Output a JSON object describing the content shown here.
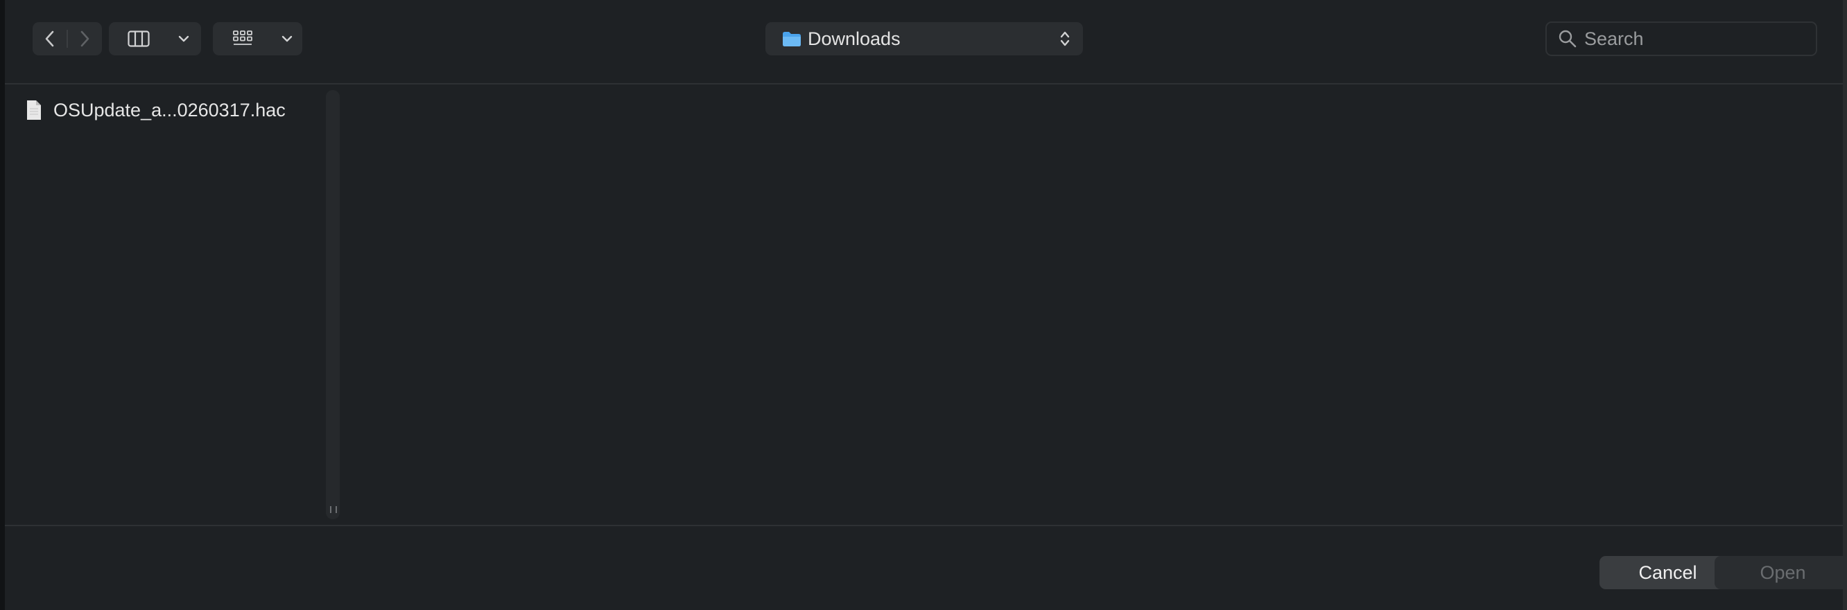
{
  "toolbar": {
    "back_icon": "chevron-left-icon",
    "forward_icon": "chevron-right-icon",
    "view_icon": "column-view-icon",
    "group_icon": "grid-group-icon",
    "location": {
      "label": "Downloads",
      "icon": "folder-icon",
      "folder_color": "#5aaef2"
    },
    "search": {
      "placeholder": "Search"
    }
  },
  "browser": {
    "files": [
      {
        "name": "OSUpdate_a...0260317.hac",
        "icon": "document-icon"
      }
    ]
  },
  "footer": {
    "cancel_label": "Cancel",
    "open_label": "Open",
    "open_enabled": false
  },
  "colors": {
    "background": "#1e2124",
    "control": "#2b2e31",
    "text": "#e6e6e6"
  }
}
